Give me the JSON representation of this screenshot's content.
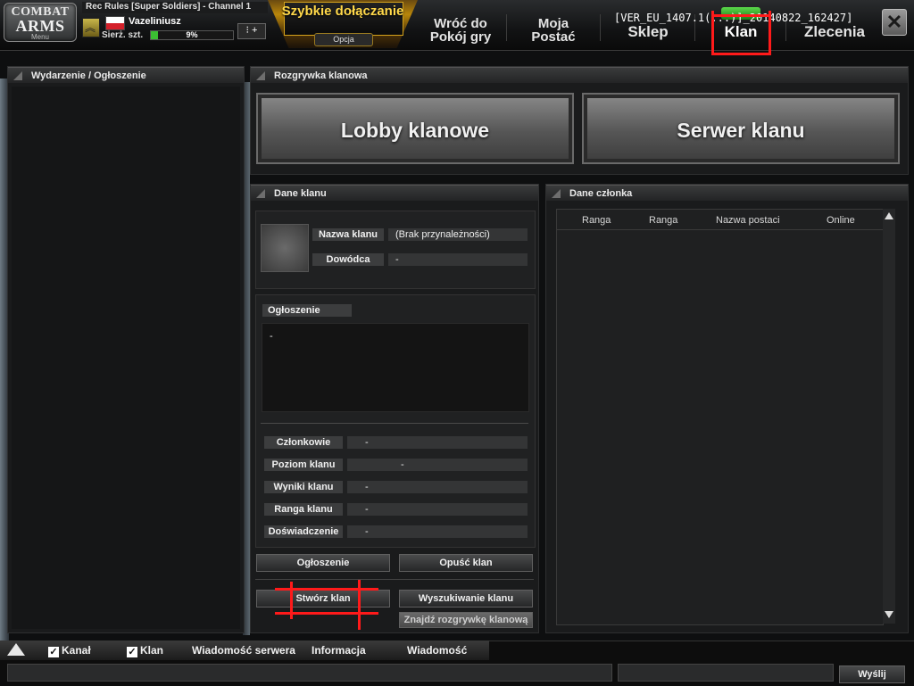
{
  "header": {
    "logo_line1": "COMBAT",
    "logo_line2": "ARMS",
    "logo_menu": "Menu",
    "room_info": "Rec Rules [Super Soldiers] - Channel 1",
    "player_name": "Vazeliniusz",
    "rank_name": "Sierż. szt.",
    "xp_percent_text": "9%",
    "xp_fraction": 0.09,
    "menu_button": "⁝ +",
    "quick_join": "Szybkie dołączanie",
    "quick_join_option": "Opcja",
    "build_version": "[VER_EU_1407.1(...)]_20140822_162427]",
    "nav": {
      "back_line1": "Wróć do",
      "back_line2": "Pokój gry",
      "char_line1": "Moja",
      "char_line2": "Postać",
      "shop": "Sklep",
      "clan": "Klan",
      "missions": "Zlecenia"
    },
    "close_glyph": "✕"
  },
  "left_panel": {
    "title": "Wydarzenie / Ogłoszenie"
  },
  "clan_war": {
    "title": "Rozgrywka klanowa",
    "lobby_button": "Lobby klanowe",
    "server_button": "Serwer klanu"
  },
  "clan_info": {
    "title": "Dane klanu",
    "name_label": "Nazwa klanu",
    "name_value": "(Brak przynależności)",
    "leader_label": "Dowódca",
    "leader_value": "-",
    "notice_label": "Ogłoszenie",
    "notice_value": "-",
    "stats": [
      {
        "label": "Członkowie",
        "value": "-"
      },
      {
        "label": "Poziom klanu",
        "value": "-"
      },
      {
        "label": "Wyniki klanu",
        "value": "-"
      },
      {
        "label": "Ranga klanu",
        "value": "-"
      },
      {
        "label": "Doświadczenie",
        "value": "-"
      }
    ],
    "buttons": {
      "notice": "Ogłoszenie",
      "leave": "Opuść klan",
      "create": "Stwórz klan",
      "search": "Wyszukiwanie klanu",
      "find_match": "Znajdź rozgrywkę klanową"
    }
  },
  "members": {
    "title": "Dane członka",
    "columns": [
      "Ranga",
      "Ranga",
      "Nazwa postaci",
      "Online"
    ]
  },
  "bottom": {
    "tabs": {
      "channel": "Kanał",
      "clan": "Klan",
      "server_msg": "Wiadomość serwera",
      "info": "Informacja",
      "message": "Wiadomość"
    },
    "check_glyph": "✓",
    "send_button": "Wyślij"
  },
  "colors": {
    "annotation_red": "#ff1a1a",
    "quick_join_gold": "#ffd84a",
    "xp_green": "#3bbf32"
  }
}
